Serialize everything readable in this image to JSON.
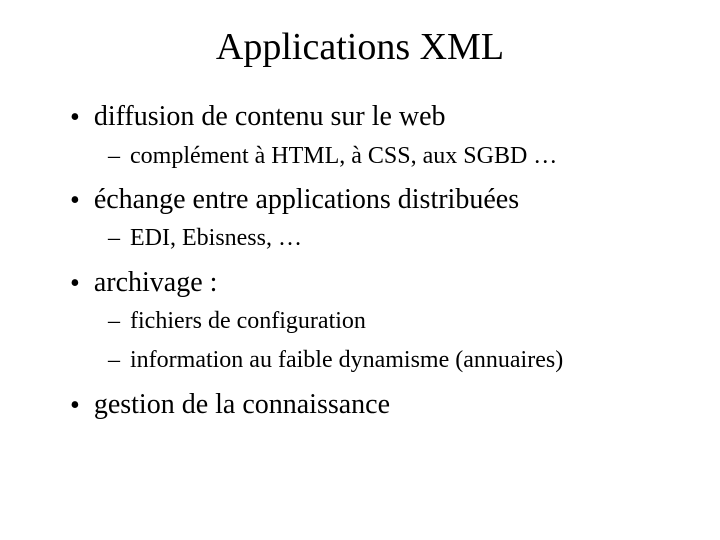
{
  "title": "Applications XML",
  "items": [
    {
      "text": "diffusion de contenu sur le web",
      "subs": [
        "complément à HTML, à CSS, aux SGBD …"
      ]
    },
    {
      "text": "échange entre applications distribuées",
      "subs": [
        "EDI, Ebisness, …"
      ]
    },
    {
      "text": "archivage :",
      "subs": [
        "fichiers de configuration",
        "information au faible dynamisme (annuaires)"
      ]
    },
    {
      "text": "gestion de la connaissance",
      "subs": []
    }
  ]
}
